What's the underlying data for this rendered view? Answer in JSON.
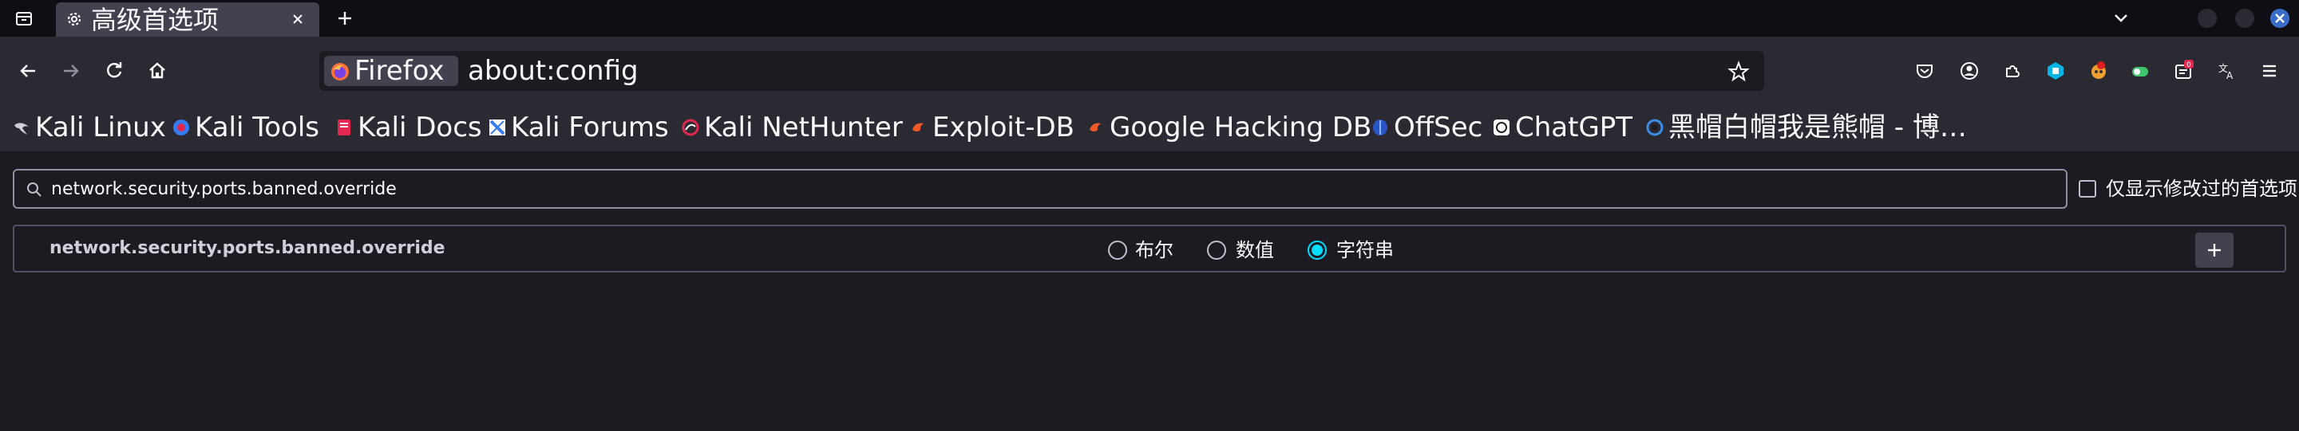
{
  "tab": {
    "title": "高级首选项",
    "icon": "gear-icon"
  },
  "urlbar": {
    "identity_label": "Firefox",
    "url": "about:config"
  },
  "bookmarks": [
    {
      "label": "Kali Linux",
      "icon": "kali-dragon-icon"
    },
    {
      "label": "Kali Tools",
      "icon": "kali-tools-icon"
    },
    {
      "label": "Kali Docs",
      "icon": "kali-docs-icon"
    },
    {
      "label": "Kali Forums",
      "icon": "kali-forums-icon"
    },
    {
      "label": "Kali NetHunter",
      "icon": "nethunter-icon"
    },
    {
      "label": "Exploit-DB",
      "icon": "exploit-db-icon"
    },
    {
      "label": "Google Hacking DB",
      "icon": "ghdb-icon"
    },
    {
      "label": "OffSec",
      "icon": "offsec-icon"
    },
    {
      "label": "ChatGPT",
      "icon": "chatgpt-icon"
    },
    {
      "label": "黑帽白帽我是熊帽 - 博…",
      "icon": "globe-icon"
    }
  ],
  "config": {
    "search_value": "network.security.ports.banned.override",
    "search_placeholder": "",
    "show_modified_label": "仅显示修改过的首选项",
    "show_modified_checked": false,
    "pref_name": "network.security.ports.banned.override",
    "types": [
      {
        "label": "布尔",
        "checked": false
      },
      {
        "label": "数值",
        "checked": false
      },
      {
        "label": "字符串",
        "checked": true
      }
    ]
  },
  "toolbar": {
    "extension_badge": "0"
  },
  "colors": {
    "accent": "#00ddff",
    "window_close": "#3a6cc9",
    "toolbar_bg": "#2b2a33",
    "tabstrip_bg": "#0f0e14",
    "content_bg": "#1c1b22"
  }
}
